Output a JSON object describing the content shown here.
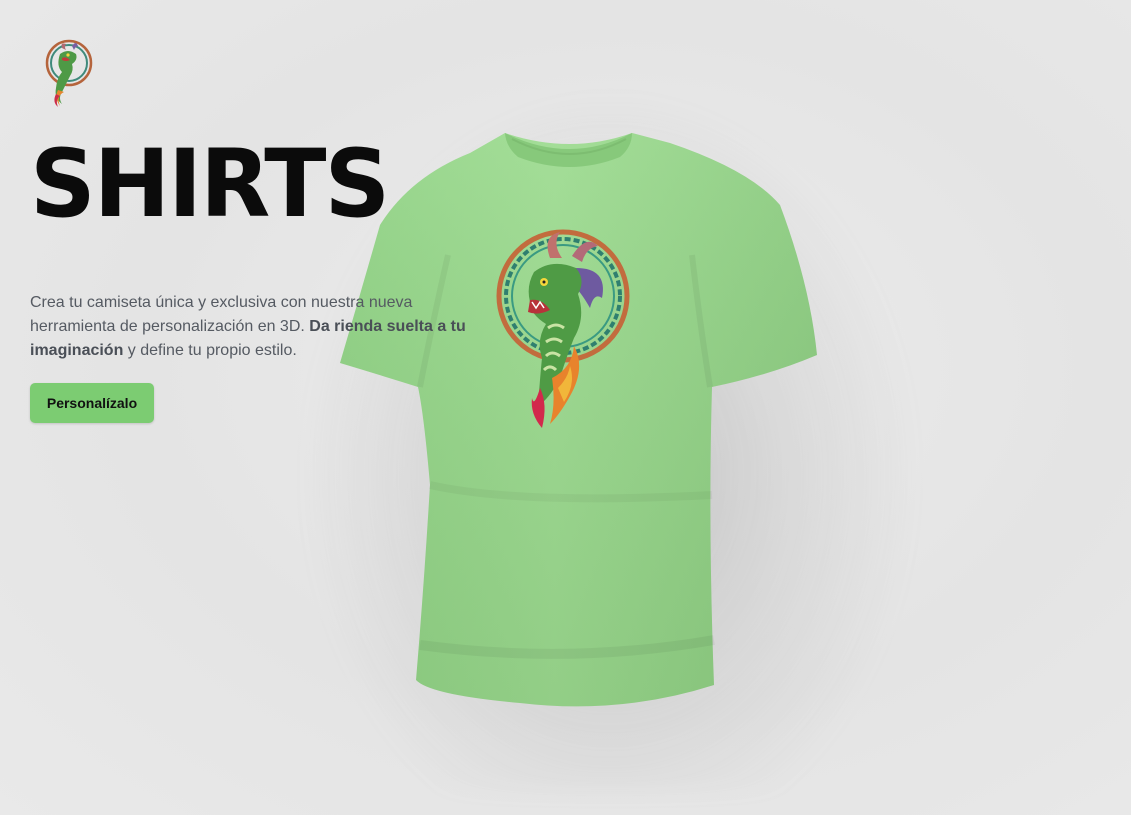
{
  "brand": {
    "logo_icon": "dragon-emblem-icon"
  },
  "hero": {
    "title": "SHIRTS",
    "description_part1": "Crea tu camiseta única y exclusiva con nuestra nueva herramienta de personalización en 3D. ",
    "description_bold": "Da rienda suelta a tu imaginación",
    "description_part2": " y define tu propio estilo.",
    "cta_label": "Personalízalo"
  },
  "product": {
    "shirt_color": "#98d88a",
    "decal_icon": "dragon-emblem-icon"
  },
  "colors": {
    "accent": "#7ccc72",
    "background": "#e6e6e6",
    "title": "#0b0b0b",
    "body_text": "#555a62"
  }
}
